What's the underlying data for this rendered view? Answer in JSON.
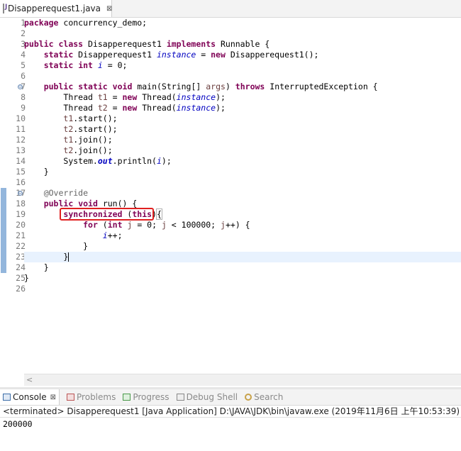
{
  "editor_tab": {
    "title": "Disapperequest1.java",
    "close": "⊠"
  },
  "line_numbers": [
    "1",
    "2",
    "3",
    "4",
    "5",
    "6",
    "7",
    "8",
    "9",
    "10",
    "11",
    "12",
    "13",
    "14",
    "15",
    "16",
    "17",
    "18",
    "19",
    "20",
    "21",
    "22",
    "23",
    "24",
    "25",
    "26"
  ],
  "fold_marks": {
    "7": "⊖",
    "17": "⊖"
  },
  "code": {
    "l1": {
      "kw": "package",
      "rest": " concurrency_demo;"
    },
    "l3": {
      "kw1": "public",
      "kw2": "class",
      "name": " Disapperequest1 ",
      "kw3": "implements",
      "rest": " Runnable {"
    },
    "l4": {
      "kw1": "static",
      "type": " Disapperequest1 ",
      "field": "instance",
      "eq": " = ",
      "kw2": "new",
      "rest": " Disapperequest1();"
    },
    "l5": {
      "kw1": "static",
      "kw2": "int",
      "field": "i",
      "rest": " = 0;"
    },
    "l7": {
      "kw1": "public",
      "kw2": "static",
      "kw3": "void",
      "mid": " main(String[] ",
      "param": "args",
      "close": ") ",
      "kw4": "throws",
      "rest": " InterruptedException {"
    },
    "l8": {
      "type": "Thread ",
      "var": "t1",
      "eq": " = ",
      "kw": "new",
      "call": " Thread(",
      "field": "instance",
      "rest": ");"
    },
    "l9": {
      "type": "Thread ",
      "var": "t2",
      "eq": " = ",
      "kw": "new",
      "call": " Thread(",
      "field": "instance",
      "rest": ");"
    },
    "l10": {
      "var": "t1",
      "rest": ".start();"
    },
    "l11": {
      "var": "t2",
      "rest": ".start();"
    },
    "l12": {
      "var": "t1",
      "rest": ".join();"
    },
    "l13": {
      "var": "t2",
      "rest": ".join();"
    },
    "l14": {
      "pre": "System.",
      "field": "out",
      "mid": ".println(",
      "field2": "i",
      "rest": ");"
    },
    "l15": "}",
    "l17": "@Override",
    "l18": {
      "kw1": "public",
      "kw2": "void",
      "rest": " run() {"
    },
    "l19": {
      "kw": "synchronized",
      "mid": " (",
      "kw2": "this",
      "close": ")",
      "brace": "{"
    },
    "l20": {
      "kw": "for",
      "mid": " (",
      "kw2": "int",
      "var": "j",
      "a": " = 0; ",
      "var2": "j",
      "b": " < 100000; ",
      "var3": "j",
      "rest": "++) {"
    },
    "l21": {
      "field": "i",
      "rest": "++;"
    },
    "l22": "}",
    "l23": "}",
    "l24": "}",
    "l25": "}"
  },
  "scroll_arrow": "<",
  "console": {
    "tabs": [
      {
        "label": "Console",
        "close": "⊠"
      },
      {
        "label": "Problems"
      },
      {
        "label": "Progress"
      },
      {
        "label": "Debug Shell"
      },
      {
        "label": "Search"
      }
    ],
    "status": "<terminated> Disapperequest1 [Java Application] D:\\JAVA\\JDK\\bin\\javaw.exe (2019年11月6日 上午10:53:39)",
    "output": "200000"
  }
}
